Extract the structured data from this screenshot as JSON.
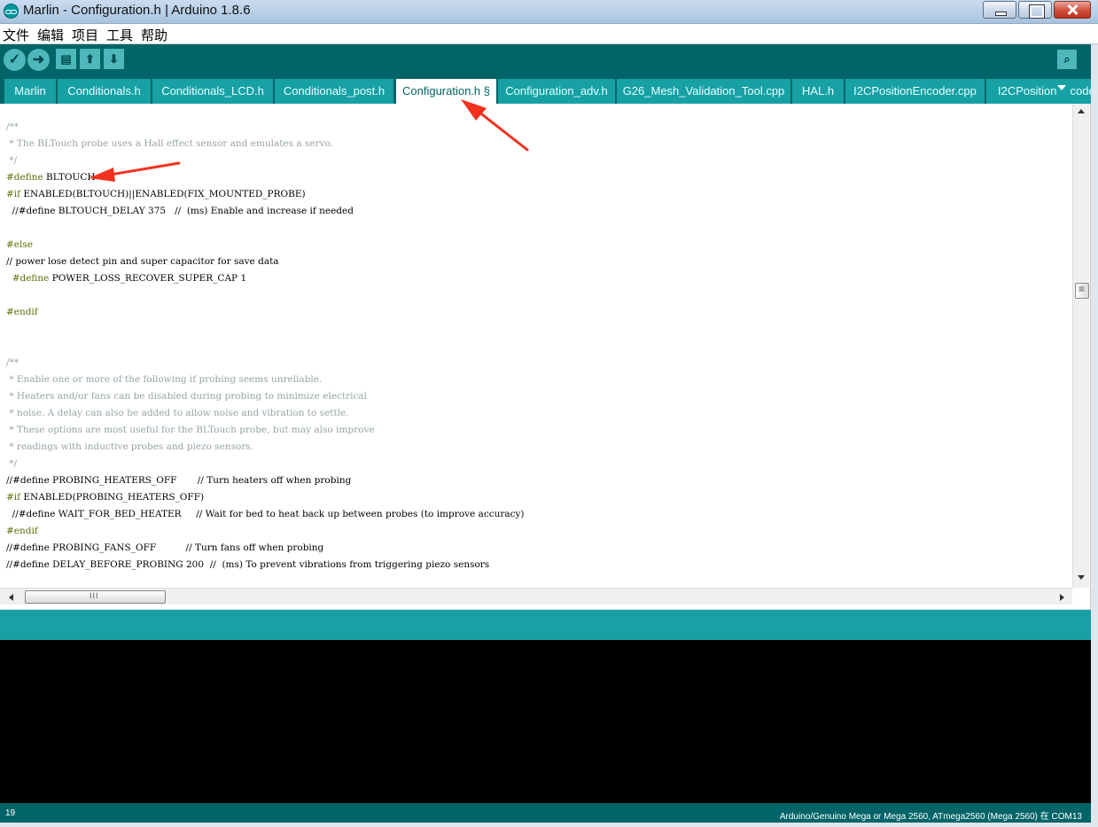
{
  "window": {
    "title": "Marlin - Configuration.h | Arduino 1.8.6"
  },
  "menu": {
    "items": [
      "文件",
      "编辑",
      "项目",
      "工具",
      "帮助"
    ]
  },
  "toolbar": {
    "verify_icon": "checkmark-icon",
    "upload_icon": "arrow-right-icon",
    "new_icon": "new-file-icon",
    "open_icon": "upload-arrow-icon",
    "save_icon": "download-arrow-icon",
    "serial_icon": "serial-monitor-icon"
  },
  "tabs": [
    {
      "label": "Marlin"
    },
    {
      "label": "Conditionals.h"
    },
    {
      "label": "Conditionals_LCD.h"
    },
    {
      "label": "Conditionals_post.h"
    },
    {
      "label": "Configuration.h §"
    },
    {
      "label": "Configuration_adv.h"
    },
    {
      "label": "G26_Mesh_Validation_Tool.cpp"
    },
    {
      "label": "HAL.h"
    },
    {
      "label": "I2CPositionEncoder.cpp"
    },
    {
      "label": "I2CPosition"
    },
    {
      "label": "code"
    }
  ],
  "editor": {
    "lines": [
      {
        "parts": [
          {
            "t": "/**",
            "c": "cm"
          }
        ]
      },
      {
        "parts": [
          {
            "t": " * The BLTouch probe uses a Hall effect sensor and emulates a servo.",
            "c": "cm"
          }
        ]
      },
      {
        "parts": [
          {
            "t": " */",
            "c": "cm"
          }
        ]
      },
      {
        "parts": [
          {
            "t": "#define",
            "c": "kw-pre"
          },
          {
            "t": " BLTOUCH",
            "c": ""
          }
        ]
      },
      {
        "parts": [
          {
            "t": "#if",
            "c": "kw-pre"
          },
          {
            "t": " ENABLED(BLTOUCH)||ENABLED(FIX_MOUNTED_PROBE)",
            "c": ""
          }
        ]
      },
      {
        "parts": [
          {
            "t": "  //#define BLTOUCH_DELAY 375   //  (ms) Enable and increase if needed",
            "c": ""
          }
        ]
      },
      {
        "parts": [
          {
            "t": "",
            "c": ""
          }
        ]
      },
      {
        "parts": [
          {
            "t": "#else",
            "c": "kw-pre"
          }
        ]
      },
      {
        "parts": [
          {
            "t": "// power lose detect pin and super capacitor for save data",
            "c": ""
          }
        ]
      },
      {
        "parts": [
          {
            "t": "  ",
            "c": ""
          },
          {
            "t": "#define",
            "c": "kw-pre"
          },
          {
            "t": " POWER_LOSS_RECOVER_SUPER_CAP 1",
            "c": ""
          }
        ]
      },
      {
        "parts": [
          {
            "t": "",
            "c": ""
          }
        ]
      },
      {
        "parts": [
          {
            "t": "#endif",
            "c": "kw-pre"
          }
        ]
      },
      {
        "parts": [
          {
            "t": "",
            "c": ""
          }
        ]
      },
      {
        "parts": [
          {
            "t": "",
            "c": ""
          }
        ]
      },
      {
        "parts": [
          {
            "t": "/**",
            "c": "cm"
          }
        ]
      },
      {
        "parts": [
          {
            "t": " * Enable one or more of the following if probing seems unreliable.",
            "c": "cm"
          }
        ]
      },
      {
        "parts": [
          {
            "t": " * Heaters and/or fans can be disabled during probing to minimize electrical",
            "c": "cm"
          }
        ]
      },
      {
        "parts": [
          {
            "t": " * noise. A delay can also be added to allow noise and vibration to settle.",
            "c": "cm"
          }
        ]
      },
      {
        "parts": [
          {
            "t": " * These options are most useful for the BLTouch probe, but may also improve",
            "c": "cm"
          }
        ]
      },
      {
        "parts": [
          {
            "t": " * readings with inductive probes and piezo sensors.",
            "c": "cm"
          }
        ]
      },
      {
        "parts": [
          {
            "t": " */",
            "c": "cm"
          }
        ]
      },
      {
        "parts": [
          {
            "t": "//#define PROBING_HEATERS_OFF       // Turn heaters off when probing",
            "c": ""
          }
        ]
      },
      {
        "parts": [
          {
            "t": "#if",
            "c": "kw-pre"
          },
          {
            "t": " ENABLED(PROBING_HEATERS_OFF)",
            "c": ""
          }
        ]
      },
      {
        "parts": [
          {
            "t": "  //#define WAIT_FOR_BED_HEATER     // Wait for bed to heat back up between probes (to improve accuracy)",
            "c": ""
          }
        ]
      },
      {
        "parts": [
          {
            "t": "#endif",
            "c": "kw-pre"
          }
        ]
      },
      {
        "parts": [
          {
            "t": "//#define PROBING_FANS_OFF          // Turn fans off when probing",
            "c": ""
          }
        ]
      },
      {
        "parts": [
          {
            "t": "//#define DELAY_BEFORE_PROBING 200  //  (ms) To prevent vibrations from triggering piezo sensors",
            "c": ""
          }
        ]
      }
    ]
  },
  "status": {
    "line_number": "19",
    "board": "Arduino/Genuino Mega or Mega 2560, ATmega2560 (Mega 2560) 在 COM13"
  },
  "colors": {
    "teal_dark": "#006468",
    "teal_mid": "#17a1a5",
    "annotation_red": "#f0321e"
  }
}
